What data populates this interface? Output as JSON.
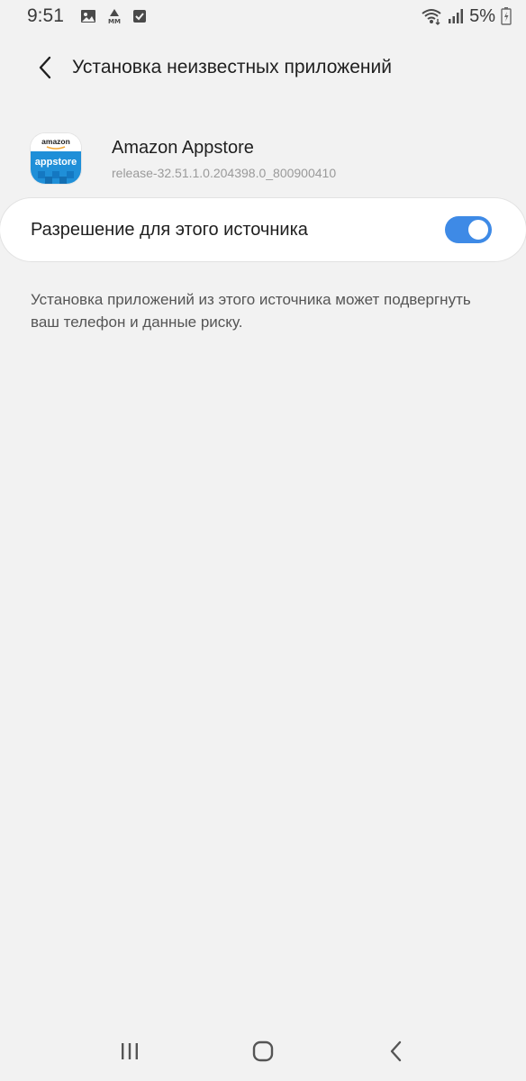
{
  "status_bar": {
    "time": "9:51",
    "battery_percent": "5%",
    "left_icons": [
      "image-icon",
      "mm-icon",
      "checkbox-icon"
    ],
    "right_icons": [
      "wifi-icon",
      "signal-icon",
      "battery-icon"
    ]
  },
  "header": {
    "title": "Установка неизвестных приложений"
  },
  "app": {
    "name": "Amazon Appstore",
    "version": "release-32.51.1.0.204398.0_800900410",
    "icon_text_top": "amazon",
    "icon_text_main": "appstore",
    "icon_color": "#1f8fd8"
  },
  "permission": {
    "label": "Разрешение для этого источника",
    "enabled": true,
    "accent_color": "#3e8ae6"
  },
  "warning": {
    "text": "Установка приложений из этого источника может подвергнуть ваш телефон и данные риску."
  },
  "nav": {
    "buttons": [
      "recent-apps-icon",
      "home-icon",
      "back-icon"
    ]
  }
}
